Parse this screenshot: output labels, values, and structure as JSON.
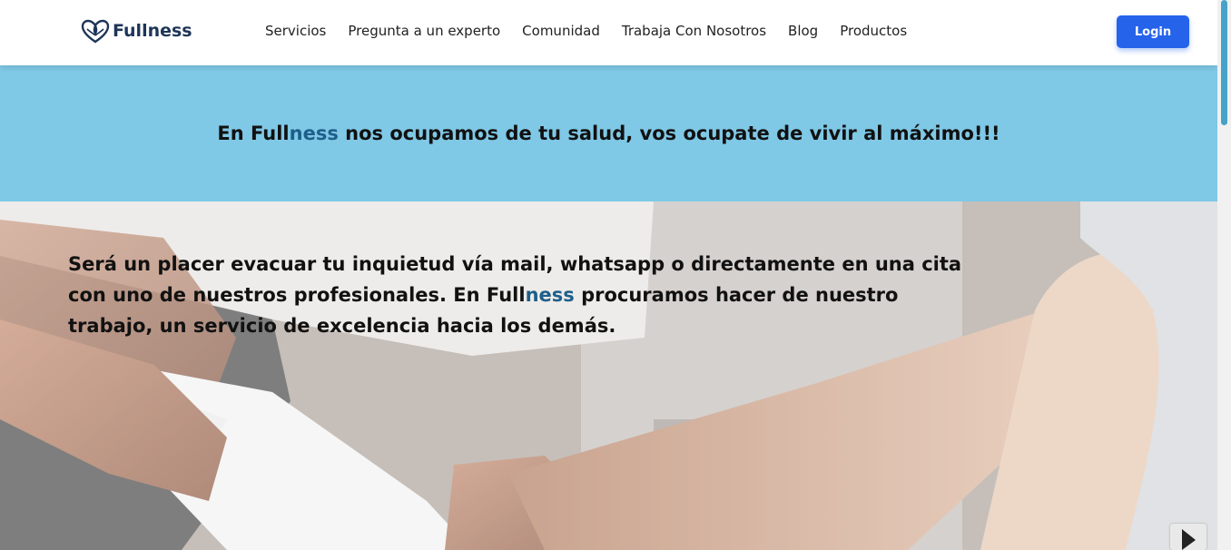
{
  "brand": {
    "name": "Fullness"
  },
  "nav": {
    "items": [
      {
        "label": "Servicios"
      },
      {
        "label": "Pregunta a un experto"
      },
      {
        "label": "Comunidad"
      },
      {
        "label": "Trabaja Con Nosotros"
      },
      {
        "label": "Blog"
      },
      {
        "label": "Productos"
      }
    ],
    "login_label": "Login"
  },
  "banner": {
    "pre": "En Full",
    "accent": "ness",
    "post": " nos ocupamos de tu salud, vos ocupate de vivir al máximo!!!"
  },
  "hero": {
    "pre": "Será un placer evacuar tu inquietud vía mail, whatsapp o directamente en una cita con uno de nuestros profesionales. En Full",
    "accent": "ness",
    "post": " procuramos hacer de nuestro trabajo, un servicio de excelencia hacia los demás."
  },
  "colors": {
    "banner_bg": "#7fc8e6",
    "accent": "#1d5f8a",
    "login_bg": "#2563eb",
    "brand_text": "#1d3557"
  },
  "icons": {
    "logo": "lotus-heart-icon",
    "carousel_next": "chevron-right-icon"
  }
}
